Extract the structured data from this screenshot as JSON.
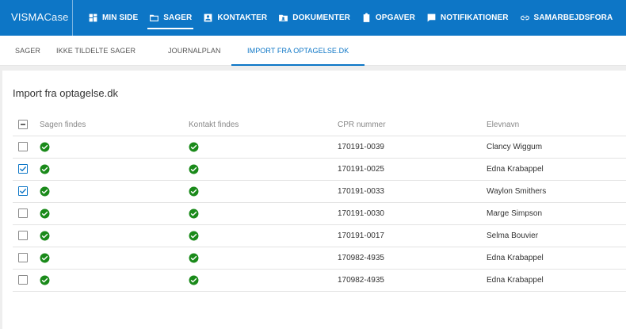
{
  "header": {
    "logo_brand": "VISMA",
    "logo_product": "Case",
    "nav": [
      {
        "label": "MIN SIDE",
        "icon": "dashboard-icon",
        "active": false
      },
      {
        "label": "SAGER",
        "icon": "folder-icon",
        "active": true
      },
      {
        "label": "KONTAKTER",
        "icon": "contact-icon",
        "active": false
      },
      {
        "label": "DOKUMENTER",
        "icon": "document-icon",
        "active": false
      },
      {
        "label": "OPGAVER",
        "icon": "clipboard-icon",
        "active": false
      },
      {
        "label": "NOTIFIKATIONER",
        "icon": "notification-icon",
        "active": false
      },
      {
        "label": "SAMARBEJDSFORA",
        "icon": "link-icon",
        "active": false
      }
    ]
  },
  "subtabs": [
    {
      "label": "SAGER",
      "active": false
    },
    {
      "label": "IKKE TILDELTE SAGER",
      "active": false
    },
    {
      "label": "JOURNALPLAN",
      "active": false
    },
    {
      "label": "IMPORT FRA OPTAGELSE.DK",
      "active": true
    }
  ],
  "page": {
    "title": "Import fra optagelse.dk"
  },
  "table": {
    "columns": [
      "Sagen findes",
      "Kontakt findes",
      "CPR nummer",
      "Elevnavn"
    ],
    "rows": [
      {
        "checked": false,
        "sagen_findes": true,
        "kontakt_findes": true,
        "cpr": "170191-0039",
        "navn": "Clancy Wiggum"
      },
      {
        "checked": true,
        "sagen_findes": true,
        "kontakt_findes": true,
        "cpr": "170191-0025",
        "navn": "Edna Krabappel"
      },
      {
        "checked": true,
        "sagen_findes": true,
        "kontakt_findes": true,
        "cpr": "170191-0033",
        "navn": "Waylon Smithers"
      },
      {
        "checked": false,
        "sagen_findes": true,
        "kontakt_findes": true,
        "cpr": "170191-0030",
        "navn": "Marge Simpson"
      },
      {
        "checked": false,
        "sagen_findes": true,
        "kontakt_findes": true,
        "cpr": "170191-0017",
        "navn": "Selma Bouvier"
      },
      {
        "checked": false,
        "sagen_findes": true,
        "kontakt_findes": true,
        "cpr": "170982-4935",
        "navn": "Edna Krabappel"
      },
      {
        "checked": false,
        "sagen_findes": true,
        "kontakt_findes": true,
        "cpr": "170982-4935",
        "navn": "Edna Krabappel"
      }
    ]
  },
  "colors": {
    "primary": "#0d76c6",
    "success": "#1a8a1a"
  }
}
